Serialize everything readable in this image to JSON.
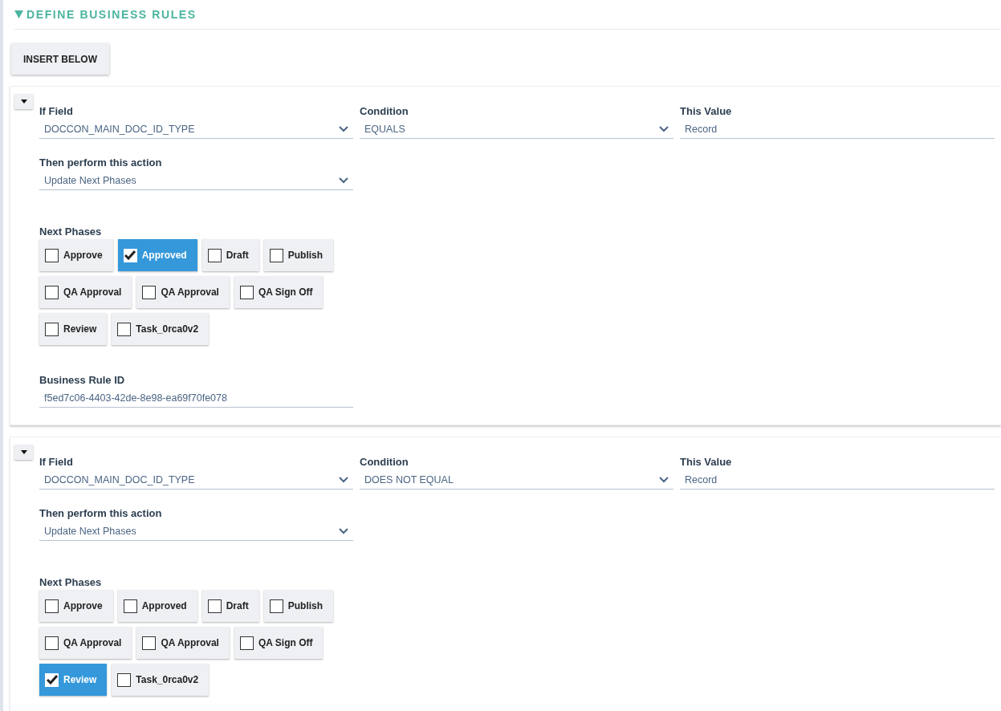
{
  "section": {
    "title": "DEFINE BUSINESS RULES",
    "expanded": true
  },
  "insert_button": "INSERT BELOW",
  "rules": [
    {
      "if_field": {
        "label": "If Field",
        "value": "DOCCON_MAIN_DOC_ID_TYPE"
      },
      "condition": {
        "label": "Condition",
        "value": "EQUALS"
      },
      "this_value": {
        "label": "This Value",
        "value": "Record"
      },
      "action": {
        "label": "Then perform this action",
        "value": "Update Next Phases"
      },
      "next_phases_label": "Next Phases",
      "phases": [
        {
          "label": "Approve",
          "checked": false
        },
        {
          "label": "Approved",
          "checked": true
        },
        {
          "label": "Draft",
          "checked": false
        },
        {
          "label": "Publish",
          "checked": false
        },
        {
          "label": "QA Approval",
          "checked": false
        },
        {
          "label": "QA Approval",
          "checked": false
        },
        {
          "label": "QA Sign Off",
          "checked": false
        },
        {
          "label": "Review",
          "checked": false
        },
        {
          "label": "Task_0rca0v2",
          "checked": false
        }
      ],
      "business_rule_id": {
        "label": "Business Rule ID",
        "value": "f5ed7c06-4403-42de-8e98-ea69f70fe078"
      }
    },
    {
      "if_field": {
        "label": "If Field",
        "value": "DOCCON_MAIN_DOC_ID_TYPE"
      },
      "condition": {
        "label": "Condition",
        "value": "DOES NOT EQUAL"
      },
      "this_value": {
        "label": "This Value",
        "value": "Record"
      },
      "action": {
        "label": "Then perform this action",
        "value": "Update Next Phases"
      },
      "next_phases_label": "Next Phases",
      "phases": [
        {
          "label": "Approve",
          "checked": false
        },
        {
          "label": "Approved",
          "checked": false
        },
        {
          "label": "Draft",
          "checked": false
        },
        {
          "label": "Publish",
          "checked": false
        },
        {
          "label": "QA Approval",
          "checked": false
        },
        {
          "label": "QA Approval",
          "checked": false
        },
        {
          "label": "QA Sign Off",
          "checked": false
        },
        {
          "label": "Review",
          "checked": true
        },
        {
          "label": "Task_0rca0v2",
          "checked": false
        }
      ]
    }
  ]
}
